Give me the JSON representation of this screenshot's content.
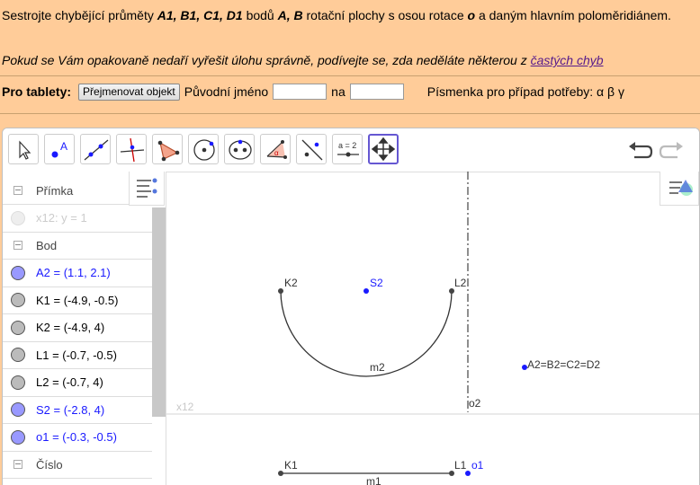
{
  "task": {
    "p1": "Sestrojte chybějící průměty ",
    "bold1": "A1, B1, C1, D1",
    "p2": " bodů ",
    "bold2": "A, B",
    "p3": " rotační plochy s osou rotace ",
    "bold3": "o",
    "p4": " a daným hlavním poloměridiánem.",
    "hint_text": "Pokud se Vám opakovaně nedaří vyřešit úlohu správně, podívejte se, zda neděláte některou z ",
    "hint_link": "častých chyb"
  },
  "tablets": {
    "label": "Pro tablety:",
    "rename_button": "Přejmenovat objekt",
    "original_name_label": "Původní jméno",
    "to_label": "na",
    "letters_label": "Písmenka pro případ potřeby: α β γ"
  },
  "toolbar": {
    "tools": [
      "move",
      "point",
      "line",
      "perpendicular-line",
      "polygon",
      "circle",
      "ellipse",
      "angle",
      "reflect",
      "slider",
      "move-graphics-view"
    ],
    "selected": "move-graphics-view",
    "slider_label": "a = 2"
  },
  "algebra": {
    "rows": [
      {
        "kind": "header",
        "label": "Přímka"
      },
      {
        "kind": "item",
        "label": "x12: y = 1",
        "color": "#cccccc",
        "dot": "#eeeeee",
        "hidden": true
      },
      {
        "kind": "header",
        "label": "Bod"
      },
      {
        "kind": "item",
        "label": "A2 = (1.1, 2.1)",
        "color": "#1a1aff",
        "dot": "#9999ff"
      },
      {
        "kind": "item",
        "label": "K1 = (-4.9, -0.5)",
        "color": "#000000",
        "dot": "#bbbbbb"
      },
      {
        "kind": "item",
        "label": "K2 = (-4.9, 4)",
        "color": "#000000",
        "dot": "#bbbbbb"
      },
      {
        "kind": "item",
        "label": "L1 = (-0.7, -0.5)",
        "color": "#000000",
        "dot": "#bbbbbb"
      },
      {
        "kind": "item",
        "label": "L2 = (-0.7, 4)",
        "color": "#000000",
        "dot": "#bbbbbb"
      },
      {
        "kind": "item",
        "label": "S2 = (-2.8, 4)",
        "color": "#1a1aff",
        "dot": "#9999ff"
      },
      {
        "kind": "item",
        "label": "o1 = (-0.3, -0.5)",
        "color": "#1a1aff",
        "dot": "#9999ff"
      },
      {
        "kind": "header",
        "label": "Číslo"
      }
    ]
  },
  "graphics": {
    "labels": {
      "K2": "K2",
      "S2": "S2",
      "L2": "L2",
      "m2": "m2",
      "A2": "A2=B2=C2=D2",
      "o2": "o2",
      "x12": "x12",
      "K1": "K1",
      "L1": "L1",
      "o1": "o1",
      "m1": "m1"
    }
  }
}
